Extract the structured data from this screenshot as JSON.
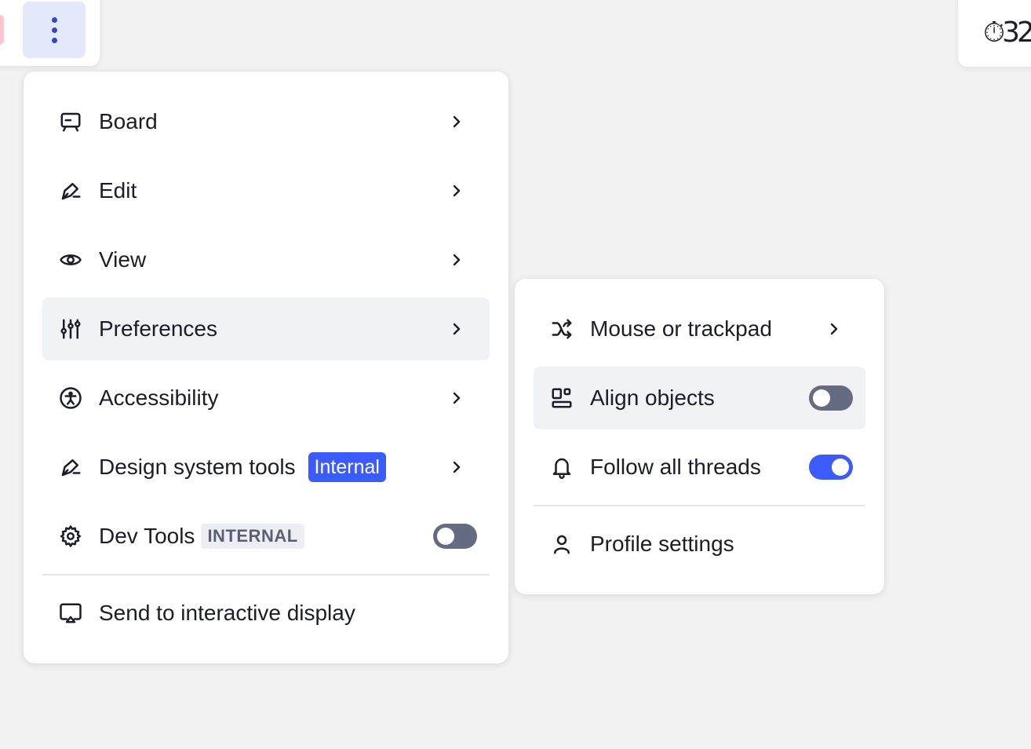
{
  "toolbar": {
    "more_button_icon": "more-vertical-icon",
    "timer_fragment": "⏱32"
  },
  "main_menu": {
    "items": [
      {
        "label": "Board",
        "icon": "board-icon",
        "submenu": true
      },
      {
        "label": "Edit",
        "icon": "pen-icon",
        "submenu": true
      },
      {
        "label": "View",
        "icon": "eye-icon",
        "submenu": true
      },
      {
        "label": "Preferences",
        "icon": "sliders-icon",
        "submenu": true,
        "active": true
      },
      {
        "label": "Accessibility",
        "icon": "accessibility-icon",
        "submenu": true
      },
      {
        "label": "Design system tools",
        "icon": "pen-icon",
        "badge": "Internal",
        "submenu": true
      },
      {
        "label": "Dev Tools",
        "icon": "gear-icon",
        "badge": "INTERNAL",
        "toggle": false
      },
      {
        "label": "Send to interactive display",
        "icon": "cast-icon"
      }
    ]
  },
  "preferences_menu": {
    "items": [
      {
        "label": "Mouse or trackpad",
        "icon": "shuffle-icon",
        "submenu": true
      },
      {
        "label": "Align objects",
        "icon": "align-objects-icon",
        "toggle": false,
        "active": true
      },
      {
        "label": "Follow all threads",
        "icon": "bell-icon",
        "toggle": true
      },
      {
        "label": "Profile settings",
        "icon": "user-icon"
      }
    ]
  },
  "colors": {
    "accent": "#3b5bfa",
    "toggle_off": "#656b81",
    "active_row": "#f1f2f4",
    "background": "#f2f2f2"
  }
}
